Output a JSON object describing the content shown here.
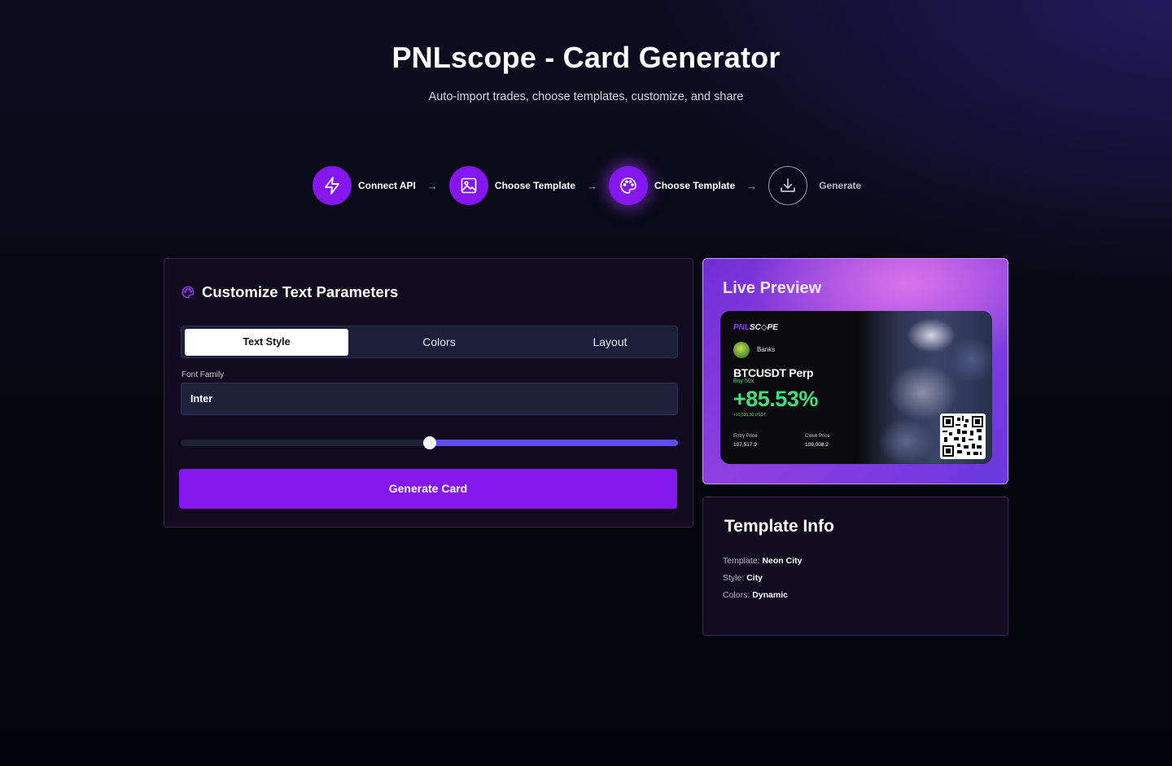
{
  "header": {
    "title": "PNLscope - Card Generator",
    "subtitle": "Auto-import trades, choose templates, customize, and share"
  },
  "steps": [
    {
      "label": "Connect API",
      "icon": "lightning-icon",
      "state": "done"
    },
    {
      "label": "Choose Template",
      "icon": "image-icon",
      "state": "done"
    },
    {
      "label": "Choose Template",
      "icon": "palette-icon",
      "state": "active"
    },
    {
      "label": "Generate",
      "icon": "download-icon",
      "state": "pending"
    }
  ],
  "step_arrow": "→",
  "customize": {
    "title": "Customize Text Parameters",
    "icon": "palette-icon",
    "tabs": [
      "Text Style",
      "Colors",
      "Layout"
    ],
    "active_tab": "Text Style",
    "font_family_label": "Font Family",
    "font_family_value": "Inter",
    "slider_value": 0.5,
    "generate_label": "Generate Card"
  },
  "preview": {
    "title": "Live Preview",
    "card": {
      "brand_left": "PNL",
      "brand_right": "SC◇PE",
      "username": "Banks",
      "pair": "BTCUSDT Perp",
      "side": "Buy 50x",
      "pnl_percent": "+85.53%",
      "pnl_usdt": "+10,535.30 USDT",
      "entry_label": "Entry Price",
      "entry_value": "107,517.9",
      "close_label": "Close Price",
      "close_value": "109,008.2"
    }
  },
  "template_info": {
    "title": "Template Info",
    "rows": [
      {
        "label": "Template:",
        "value": "Neon City"
      },
      {
        "label": "Style:",
        "value": "City"
      },
      {
        "label": "Colors:",
        "value": "Dynamic"
      }
    ]
  },
  "colors": {
    "accent": "#8417f0",
    "slider": "#5b4df2",
    "pnl_green": "#3fe07a",
    "panel_bg": "#130c20"
  }
}
